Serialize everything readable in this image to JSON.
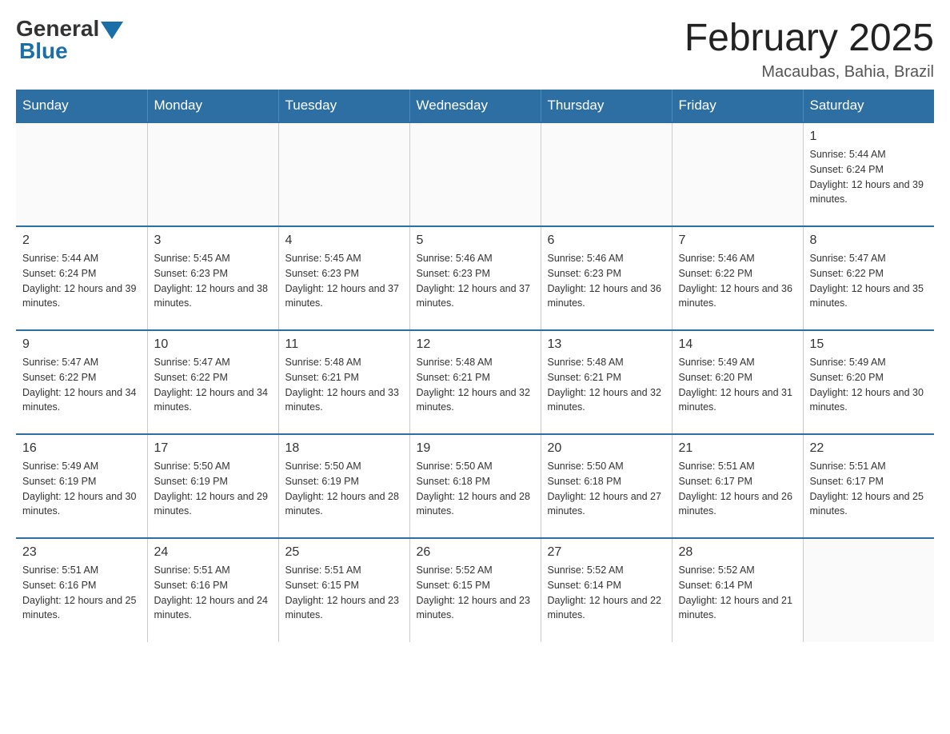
{
  "header": {
    "logo_general": "General",
    "logo_blue": "Blue",
    "title": "February 2025",
    "location": "Macaubas, Bahia, Brazil"
  },
  "weekdays": [
    "Sunday",
    "Monday",
    "Tuesday",
    "Wednesday",
    "Thursday",
    "Friday",
    "Saturday"
  ],
  "weeks": [
    [
      {
        "day": "",
        "info": ""
      },
      {
        "day": "",
        "info": ""
      },
      {
        "day": "",
        "info": ""
      },
      {
        "day": "",
        "info": ""
      },
      {
        "day": "",
        "info": ""
      },
      {
        "day": "",
        "info": ""
      },
      {
        "day": "1",
        "info": "Sunrise: 5:44 AM\nSunset: 6:24 PM\nDaylight: 12 hours and 39 minutes."
      }
    ],
    [
      {
        "day": "2",
        "info": "Sunrise: 5:44 AM\nSunset: 6:24 PM\nDaylight: 12 hours and 39 minutes."
      },
      {
        "day": "3",
        "info": "Sunrise: 5:45 AM\nSunset: 6:23 PM\nDaylight: 12 hours and 38 minutes."
      },
      {
        "day": "4",
        "info": "Sunrise: 5:45 AM\nSunset: 6:23 PM\nDaylight: 12 hours and 37 minutes."
      },
      {
        "day": "5",
        "info": "Sunrise: 5:46 AM\nSunset: 6:23 PM\nDaylight: 12 hours and 37 minutes."
      },
      {
        "day": "6",
        "info": "Sunrise: 5:46 AM\nSunset: 6:23 PM\nDaylight: 12 hours and 36 minutes."
      },
      {
        "day": "7",
        "info": "Sunrise: 5:46 AM\nSunset: 6:22 PM\nDaylight: 12 hours and 36 minutes."
      },
      {
        "day": "8",
        "info": "Sunrise: 5:47 AM\nSunset: 6:22 PM\nDaylight: 12 hours and 35 minutes."
      }
    ],
    [
      {
        "day": "9",
        "info": "Sunrise: 5:47 AM\nSunset: 6:22 PM\nDaylight: 12 hours and 34 minutes."
      },
      {
        "day": "10",
        "info": "Sunrise: 5:47 AM\nSunset: 6:22 PM\nDaylight: 12 hours and 34 minutes."
      },
      {
        "day": "11",
        "info": "Sunrise: 5:48 AM\nSunset: 6:21 PM\nDaylight: 12 hours and 33 minutes."
      },
      {
        "day": "12",
        "info": "Sunrise: 5:48 AM\nSunset: 6:21 PM\nDaylight: 12 hours and 32 minutes."
      },
      {
        "day": "13",
        "info": "Sunrise: 5:48 AM\nSunset: 6:21 PM\nDaylight: 12 hours and 32 minutes."
      },
      {
        "day": "14",
        "info": "Sunrise: 5:49 AM\nSunset: 6:20 PM\nDaylight: 12 hours and 31 minutes."
      },
      {
        "day": "15",
        "info": "Sunrise: 5:49 AM\nSunset: 6:20 PM\nDaylight: 12 hours and 30 minutes."
      }
    ],
    [
      {
        "day": "16",
        "info": "Sunrise: 5:49 AM\nSunset: 6:19 PM\nDaylight: 12 hours and 30 minutes."
      },
      {
        "day": "17",
        "info": "Sunrise: 5:50 AM\nSunset: 6:19 PM\nDaylight: 12 hours and 29 minutes."
      },
      {
        "day": "18",
        "info": "Sunrise: 5:50 AM\nSunset: 6:19 PM\nDaylight: 12 hours and 28 minutes."
      },
      {
        "day": "19",
        "info": "Sunrise: 5:50 AM\nSunset: 6:18 PM\nDaylight: 12 hours and 28 minutes."
      },
      {
        "day": "20",
        "info": "Sunrise: 5:50 AM\nSunset: 6:18 PM\nDaylight: 12 hours and 27 minutes."
      },
      {
        "day": "21",
        "info": "Sunrise: 5:51 AM\nSunset: 6:17 PM\nDaylight: 12 hours and 26 minutes."
      },
      {
        "day": "22",
        "info": "Sunrise: 5:51 AM\nSunset: 6:17 PM\nDaylight: 12 hours and 25 minutes."
      }
    ],
    [
      {
        "day": "23",
        "info": "Sunrise: 5:51 AM\nSunset: 6:16 PM\nDaylight: 12 hours and 25 minutes."
      },
      {
        "day": "24",
        "info": "Sunrise: 5:51 AM\nSunset: 6:16 PM\nDaylight: 12 hours and 24 minutes."
      },
      {
        "day": "25",
        "info": "Sunrise: 5:51 AM\nSunset: 6:15 PM\nDaylight: 12 hours and 23 minutes."
      },
      {
        "day": "26",
        "info": "Sunrise: 5:52 AM\nSunset: 6:15 PM\nDaylight: 12 hours and 23 minutes."
      },
      {
        "day": "27",
        "info": "Sunrise: 5:52 AM\nSunset: 6:14 PM\nDaylight: 12 hours and 22 minutes."
      },
      {
        "day": "28",
        "info": "Sunrise: 5:52 AM\nSunset: 6:14 PM\nDaylight: 12 hours and 21 minutes."
      },
      {
        "day": "",
        "info": ""
      }
    ]
  ]
}
